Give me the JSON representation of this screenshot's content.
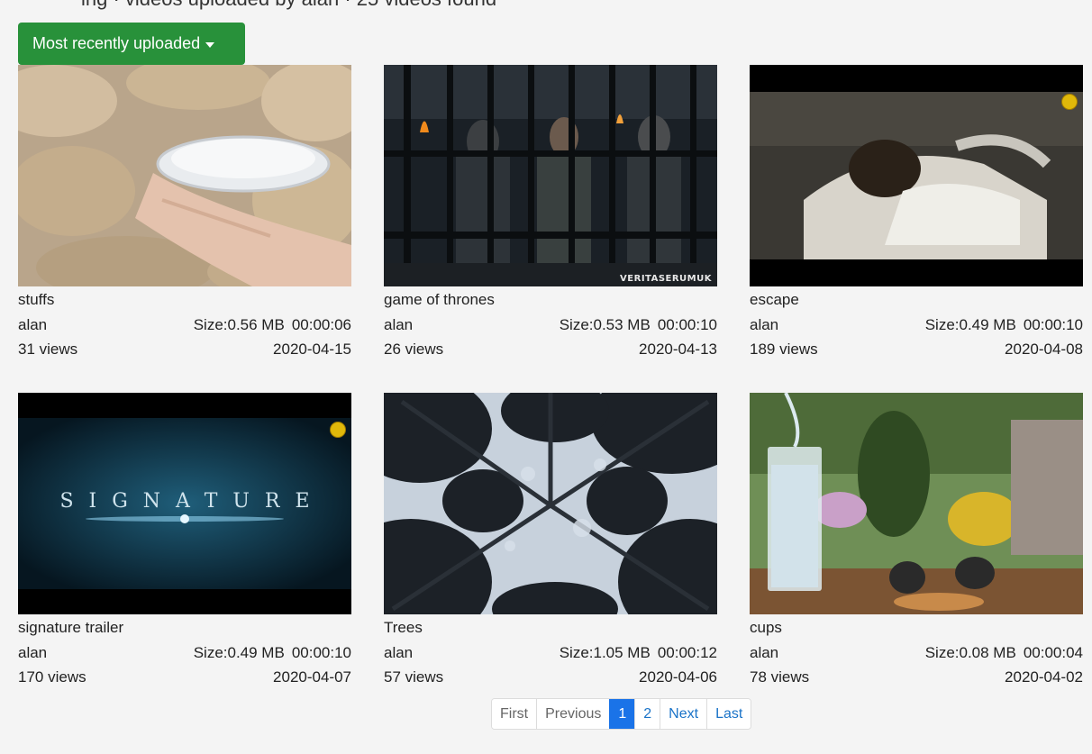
{
  "page": {
    "clipped_title": "ing · videos uploaded by alan · 25 videos found"
  },
  "sort": {
    "label": "Most recently uploaded"
  },
  "videos": [
    {
      "title": "stuffs",
      "uploader": "alan",
      "size": "Size:0.56 MB",
      "duration": "00:00:06",
      "views": "31 views",
      "date": "2020-04-15"
    },
    {
      "title": "game of thrones",
      "uploader": "alan",
      "size": "Size:0.53 MB",
      "duration": "00:00:10",
      "views": "26 views",
      "date": "2020-04-13",
      "watermark": "VERITASERUMUK"
    },
    {
      "title": "escape",
      "uploader": "alan",
      "size": "Size:0.49 MB",
      "duration": "00:00:10",
      "views": "189 views",
      "date": "2020-04-08"
    },
    {
      "title": "signature trailer",
      "uploader": "alan",
      "size": "Size:0.49 MB",
      "duration": "00:00:10",
      "views": "170 views",
      "date": "2020-04-07",
      "overlay": "SIGNATURE"
    },
    {
      "title": "Trees",
      "uploader": "alan",
      "size": "Size:1.05 MB",
      "duration": "00:00:12",
      "views": "57 views",
      "date": "2020-04-06"
    },
    {
      "title": "cups",
      "uploader": "alan",
      "size": "Size:0.08 MB",
      "duration": "00:00:04",
      "views": "78 views",
      "date": "2020-04-02"
    }
  ],
  "pagination": {
    "first": "First",
    "previous": "Previous",
    "pages": [
      "1",
      "2"
    ],
    "active_page": "1",
    "next": "Next",
    "last": "Last"
  },
  "colors": {
    "sort_button": "#28913a",
    "active_page": "#1a73e8",
    "link": "#1a73c8"
  }
}
